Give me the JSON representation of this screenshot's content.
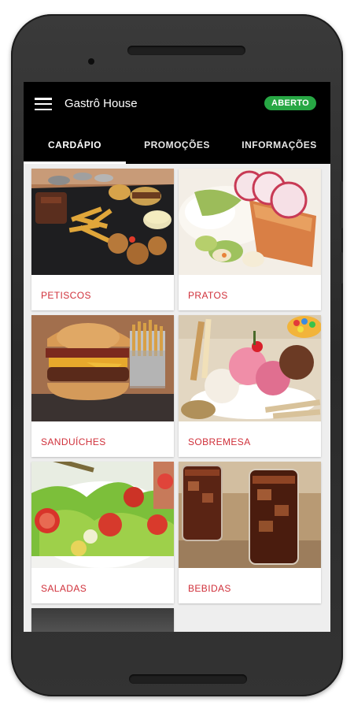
{
  "app": {
    "title": "Gastrô House",
    "status": "ABERTO",
    "menu_icon": "hamburger-menu-icon"
  },
  "tabs": [
    {
      "label": "CARDÁPIO",
      "active": true
    },
    {
      "label": "PROMOÇÕES",
      "active": false
    },
    {
      "label": "INFORMAÇÕES",
      "active": false
    }
  ],
  "categories": [
    {
      "label": "PETISCOS",
      "image": "snacks-platter-photo"
    },
    {
      "label": "PRATOS",
      "image": "grilled-fish-dish-photo"
    },
    {
      "label": "SANDUÍCHES",
      "image": "burger-with-fries-photo"
    },
    {
      "label": "SOBREMESA",
      "image": "ice-cream-sundae-photo"
    },
    {
      "label": "SALADAS",
      "image": "green-salad-photo"
    },
    {
      "label": "BEBIDAS",
      "image": "cola-glasses-photo"
    }
  ],
  "colors": {
    "appbar": "#000000",
    "status_badge": "#27a744",
    "category_label": "#d0303a",
    "background": "#eeeeee"
  }
}
